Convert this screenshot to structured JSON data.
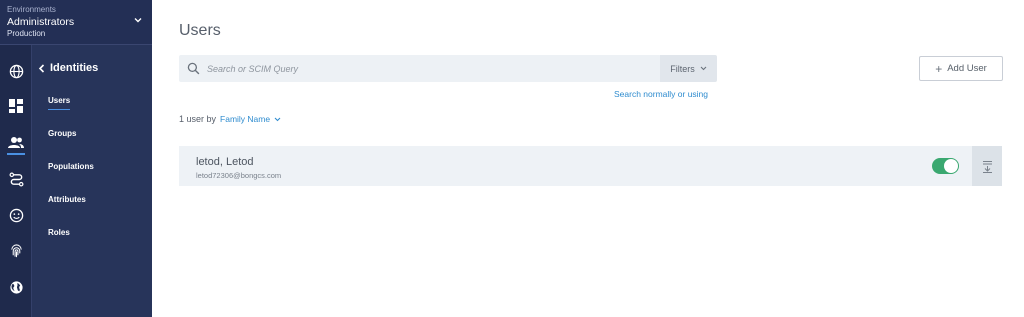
{
  "environment": {
    "label": "Environments",
    "name": "Administrators",
    "sub": "Production"
  },
  "rail": {
    "icons": [
      "globe-icon",
      "dashboard-icon",
      "users-icon",
      "connections-icon",
      "experiences-icon",
      "fingerprint-icon",
      "world-icon"
    ],
    "active": "users-icon"
  },
  "subnav": {
    "back_title": "Identities",
    "items": [
      {
        "label": "Users",
        "active": true
      },
      {
        "label": "Groups",
        "active": false
      },
      {
        "label": "Populations",
        "active": false
      },
      {
        "label": "Attributes",
        "active": false
      },
      {
        "label": "Roles",
        "active": false
      }
    ]
  },
  "main": {
    "title": "Users",
    "search": {
      "placeholder": "Search or SCIM Query",
      "filters_label": "Filters",
      "mode_link": "Search normally or using"
    },
    "add_user_label": "Add User",
    "count_text": "1 user by",
    "sort_label": "Family Name",
    "users": [
      {
        "name": "letod, Letod",
        "email": "letod72306@bongcs.com",
        "enabled": true
      }
    ]
  },
  "colors": {
    "sidebar_dark": "#1f2a4c",
    "sidebar": "#27345a",
    "accent": "#2f8ccf",
    "toggle_on": "#3aa870"
  }
}
